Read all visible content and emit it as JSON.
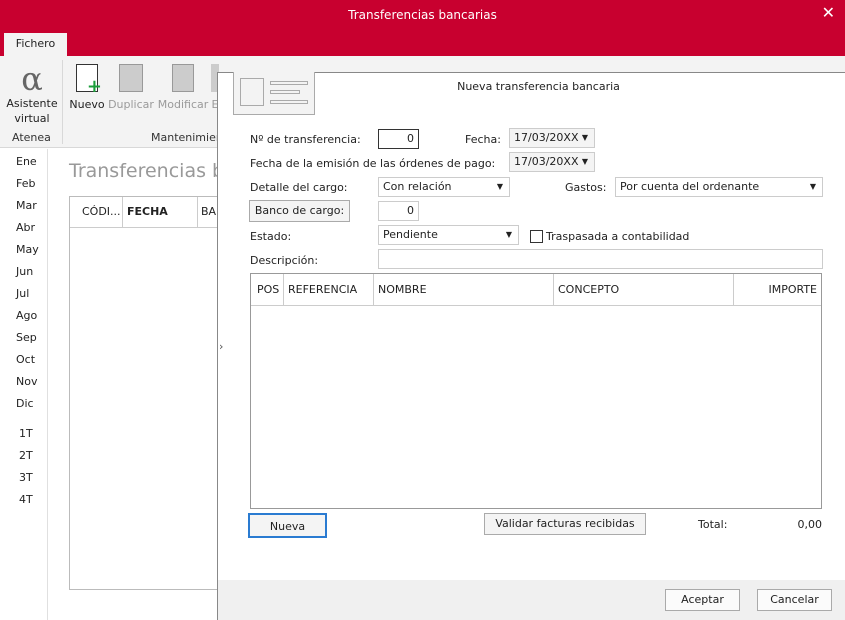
{
  "window": {
    "title": "Transferencias bancarias",
    "close": "✕"
  },
  "ribbon": {
    "tab": "Fichero",
    "buttons": [
      {
        "label": "Asistente virtual",
        "icon": "alpha-icon"
      },
      {
        "label": "Nuevo",
        "icon": "new-document-icon"
      },
      {
        "label": "Duplicar",
        "icon": "duplicate-icon"
      },
      {
        "label": "Modificar",
        "icon": "edit-icon"
      },
      {
        "label": "E",
        "icon": "delete-icon"
      }
    ],
    "groups": [
      "Atenea",
      "Mantenimien"
    ]
  },
  "months": [
    "Ene",
    "Feb",
    "Mar",
    "Abr",
    "May",
    "Jun",
    "Jul",
    "Ago",
    "Sep",
    "Oct",
    "Nov",
    "Dic"
  ],
  "quarters": [
    "1T",
    "2T",
    "3T",
    "4T"
  ],
  "main": {
    "title": "Transferencias ba",
    "columns": [
      "CÓDI...",
      "FECHA",
      "BA"
    ]
  },
  "dialog": {
    "title": "Nueva transferencia bancaria",
    "num_label": "Nº de transferencia:",
    "num_value": "0",
    "fecha_label": "Fecha:",
    "fecha_value": "17/03/20XX",
    "emision_label": "Fecha de la emisión de las órdenes de pago:",
    "emision_value": "17/03/20XX",
    "detalle_label": "Detalle del cargo:",
    "detalle_value": "Con relación",
    "gastos_label": "Gastos:",
    "gastos_value": "Por cuenta del ordenante",
    "banco_button": "Banco de cargo:",
    "banco_value": "0",
    "estado_label": "Estado:",
    "estado_value": "Pendiente",
    "traspasada_label": "Traspasada a contabilidad",
    "traspasada_checked": false,
    "descripcion_label": "Descripción:",
    "descripcion_value": "",
    "columns": [
      "POS",
      "REFERENCIA",
      "NOMBRE",
      "CONCEPTO",
      "IMPORTE"
    ],
    "nueva_button": "Nueva",
    "validar_button": "Validar facturas recibidas",
    "total_label": "Total:",
    "total_value": "0,00",
    "aceptar": "Aceptar",
    "cancelar": "Cancelar"
  }
}
